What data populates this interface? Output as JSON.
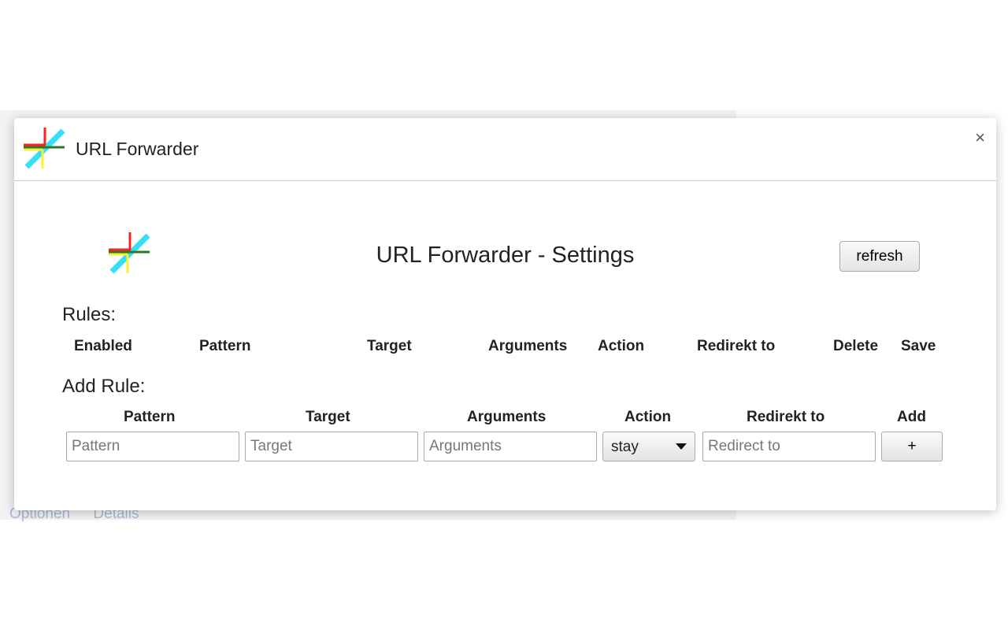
{
  "background": {
    "links": [
      "Optionen",
      "Details"
    ]
  },
  "dialog": {
    "title": "URL Forwarder",
    "close": "×",
    "heading": "URL Forwarder - Settings",
    "refresh_label": "refresh",
    "rules_label": "Rules:",
    "rules_columns": [
      "Enabled",
      "Pattern",
      "Target",
      "Arguments",
      "Action",
      "Redirekt to",
      "Delete",
      "Save"
    ],
    "add_rule_label": "Add Rule:",
    "add_columns": [
      "Pattern",
      "Target",
      "Arguments",
      "Action",
      "Redirekt to",
      "Add"
    ],
    "inputs": {
      "pattern": "Pattern",
      "target": "Target",
      "arguments": "Arguments",
      "redirect": "Redirect to"
    },
    "action_value": "stay",
    "add_button": "+"
  },
  "icons": {
    "logo": "url-forwarder-logo",
    "close": "close-icon",
    "dropdown": "chevron-down-icon"
  },
  "colors": {
    "logo_red": "#ff2020",
    "logo_cyan": "#33e0f5",
    "logo_green": "#2a7a2a",
    "logo_yellow": "#ffee33"
  }
}
